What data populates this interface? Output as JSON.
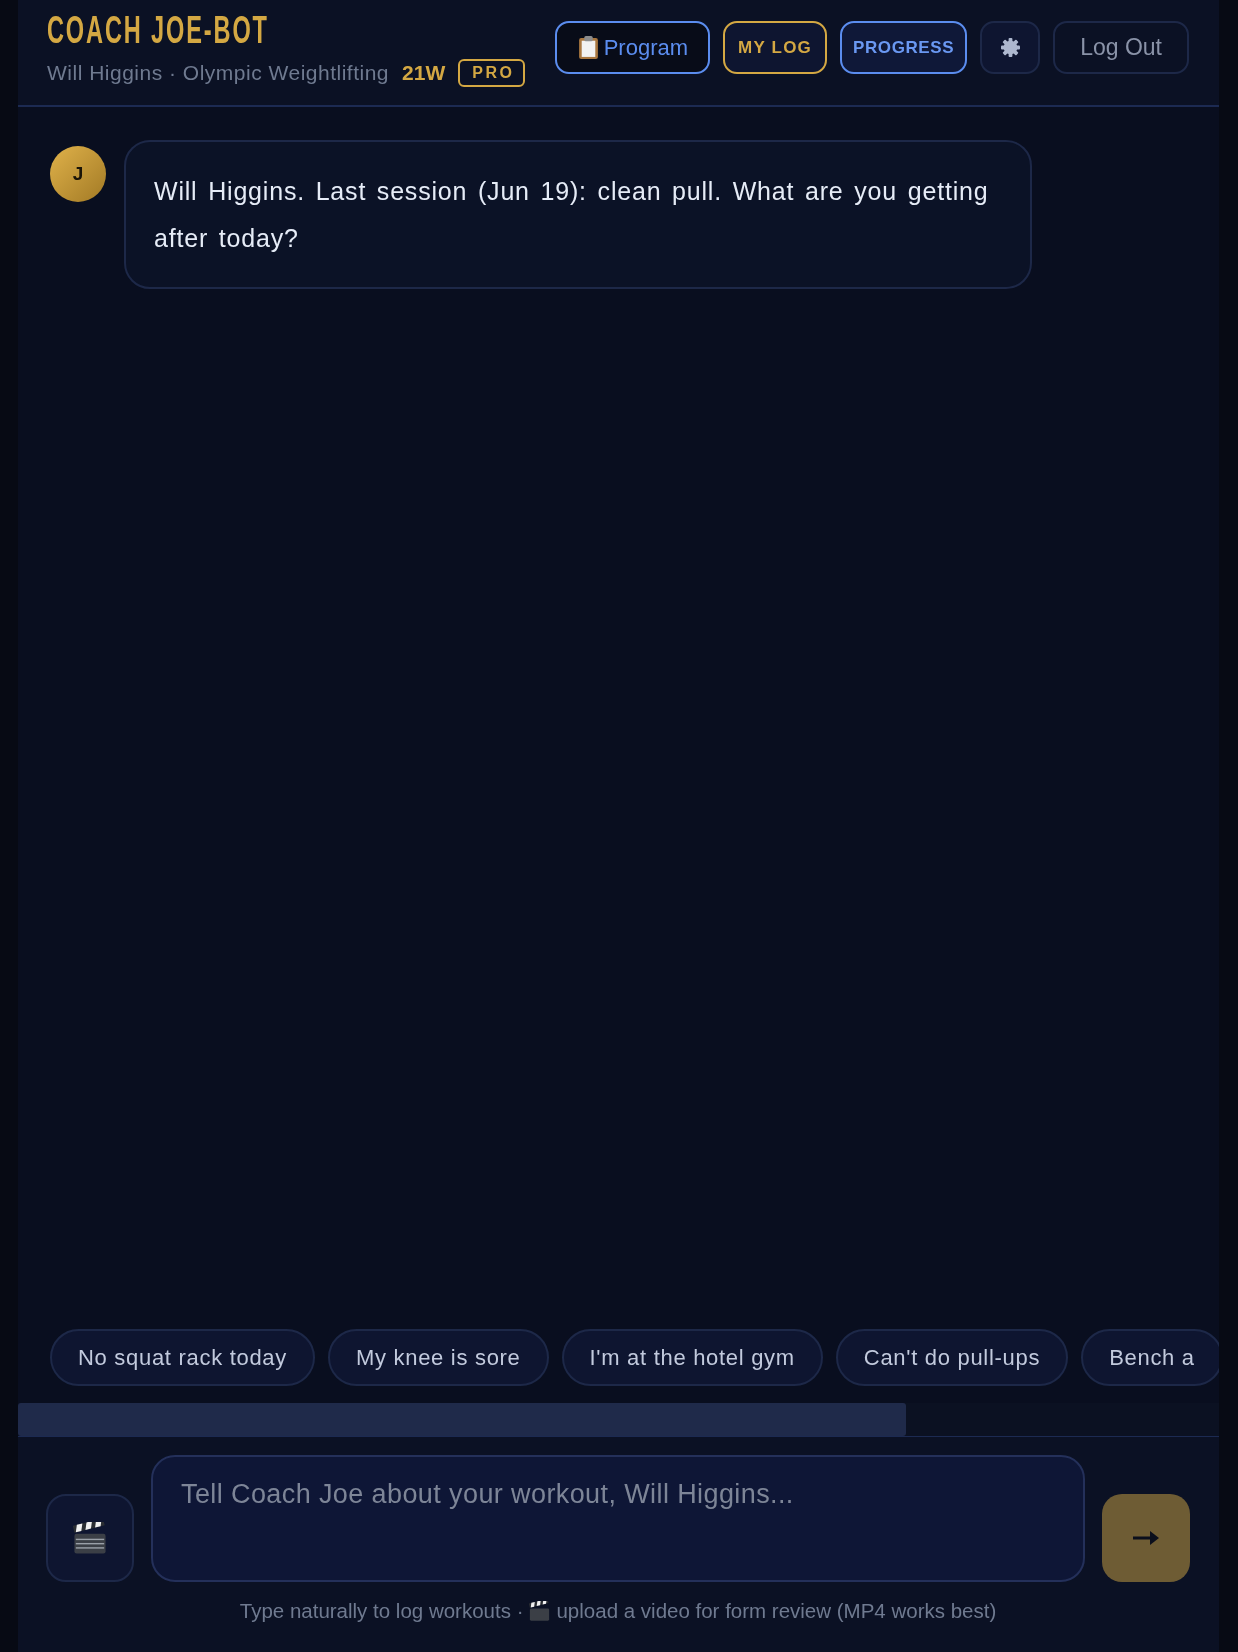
{
  "header": {
    "title": "COACH JOE-BOT",
    "user_line": "Will Higgins · Olympic Weightlifting",
    "stat": "21W",
    "badge": "PRO",
    "buttons": [
      {
        "kind": "clipboard",
        "label": "Program"
      },
      {
        "kind": "gold",
        "label": "MY LOG"
      },
      {
        "kind": "blue",
        "label": "PROGRESS"
      },
      {
        "kind": "gear"
      },
      {
        "kind": "ghost",
        "label": "Log Out"
      }
    ]
  },
  "messages": [
    {
      "kind": "coach",
      "avatar": "J",
      "text": "Will Higgins. Last session (Jun 19): clean pull. What are you getting after today?"
    }
  ],
  "suggestions": [
    "No squat rack today",
    "My knee is sore",
    "I'm at the hotel gym",
    "Can't do pull-ups",
    "Bench a"
  ],
  "composer": {
    "placeholder": "Tell Coach Joe about your workout, Will Higgins...",
    "hint_before_icon": "Type naturally to log workouts ·",
    "hint_after_icon": "upload a video for form review (MP4 works best)"
  }
}
